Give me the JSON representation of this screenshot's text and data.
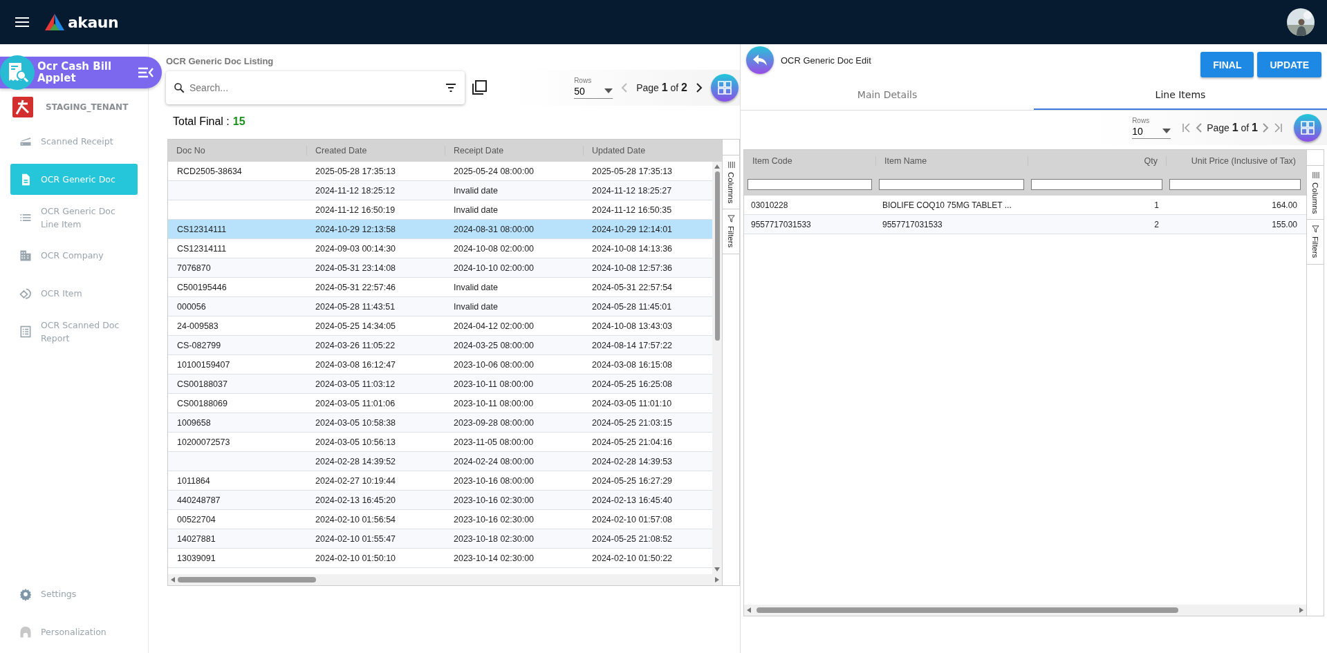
{
  "topbar": {
    "brand": "akaun"
  },
  "sidebar": {
    "app_title": "Ocr Cash Bill Applet",
    "tenant": "STAGING_TENANT",
    "items": [
      {
        "kind": "scanner",
        "label": "Scanned Receipt",
        "selected": false
      },
      {
        "kind": "file",
        "label": "OCR Generic Doc",
        "selected": true
      },
      {
        "kind": "list",
        "label": "OCR Generic Doc Line Item",
        "selected": false
      },
      {
        "kind": "building",
        "label": "OCR Company",
        "selected": false
      },
      {
        "kind": "rotate",
        "label": "OCR Item",
        "selected": false
      },
      {
        "kind": "report",
        "label": "OCR Scanned Doc Report",
        "selected": false
      }
    ],
    "footer_items": [
      {
        "kind": "gear",
        "label": "Settings"
      },
      {
        "kind": "person",
        "label": "Personalization"
      }
    ]
  },
  "listing": {
    "title": "OCR Generic Doc Listing",
    "search": {
      "placeholder": "Search..."
    },
    "rows_label": "Rows",
    "rows_value": "50",
    "page": "Page **1** of **2**",
    "total_label": "Total Final :",
    "total_value": "15",
    "columns": [
      "Doc No",
      "Created Date",
      "Receipt Date",
      "Updated Date"
    ],
    "side_tabs": [
      {
        "kind": "columns",
        "label": "Columns"
      },
      {
        "kind": "filters",
        "label": "Filters"
      }
    ],
    "rows": [
      {
        "cells": [
          "RCD2505-38634",
          "2025-05-28 17:35:13",
          "2025-05-24 08:00:00",
          "2025-05-28 17:35:13"
        ],
        "selected": false
      },
      {
        "cells": [
          "",
          "2024-11-12 18:25:12",
          "Invalid date",
          "2024-11-12 18:25:27"
        ],
        "selected": false
      },
      {
        "cells": [
          "",
          "2024-11-12 16:50:19",
          "Invalid date",
          "2024-11-12 16:50:35"
        ],
        "selected": false
      },
      {
        "cells": [
          "CS12314111",
          "2024-10-29 12:13:58",
          "2024-08-31 08:00:00",
          "2024-10-29 12:14:01"
        ],
        "selected": true
      },
      {
        "cells": [
          "CS12314111",
          "2024-09-03 00:14:30",
          "2024-10-08 02:00:00",
          "2024-10-08 14:13:36"
        ],
        "selected": false
      },
      {
        "cells": [
          "7076870",
          "2024-05-31 23:14:08",
          "2024-10-10 02:00:00",
          "2024-10-08 12:57:36"
        ],
        "selected": false
      },
      {
        "cells": [
          "C500195446",
          "2024-05-31 22:57:46",
          "Invalid date",
          "2024-05-31 22:57:54"
        ],
        "selected": false
      },
      {
        "cells": [
          "000056",
          "2024-05-28 11:43:51",
          "Invalid date",
          "2024-05-28 11:45:01"
        ],
        "selected": false
      },
      {
        "cells": [
          "24-009583",
          "2024-05-25 14:34:05",
          "2024-04-12 02:00:00",
          "2024-10-08 13:43:03"
        ],
        "selected": false
      },
      {
        "cells": [
          "CS-082799",
          "2024-03-26 11:05:22",
          "2024-03-25 08:00:00",
          "2024-08-14 17:57:22"
        ],
        "selected": false
      },
      {
        "cells": [
          "10100159407",
          "2024-03-08 16:12:47",
          "2023-10-06 08:00:00",
          "2024-03-08 16:15:08"
        ],
        "selected": false
      },
      {
        "cells": [
          "CS00188037",
          "2024-03-05 11:03:12",
          "2023-10-11 08:00:00",
          "2024-05-25 16:25:08"
        ],
        "selected": false
      },
      {
        "cells": [
          "CS00188069",
          "2024-03-05 11:01:06",
          "2023-10-11 08:00:00",
          "2024-03-05 11:01:10"
        ],
        "selected": false
      },
      {
        "cells": [
          "1009658",
          "2024-03-05 10:58:38",
          "2023-09-28 08:00:00",
          "2024-05-25 21:03:15"
        ],
        "selected": false
      },
      {
        "cells": [
          "10200072573",
          "2024-03-05 10:56:13",
          "2023-11-05 08:00:00",
          "2024-05-25 21:04:16"
        ],
        "selected": false
      },
      {
        "cells": [
          "",
          "2024-02-28 14:39:52",
          "2024-02-24 08:00:00",
          "2024-02-28 14:39:53"
        ],
        "selected": false
      },
      {
        "cells": [
          "1011864",
          "2024-02-27 10:19:44",
          "2023-10-16 08:00:00",
          "2024-05-25 16:27:29"
        ],
        "selected": false
      },
      {
        "cells": [
          "440248787",
          "2024-02-13 16:45:20",
          "2023-10-16 02:30:00",
          "2024-02-13 16:45:40"
        ],
        "selected": false
      },
      {
        "cells": [
          "00522704",
          "2024-02-10 01:56:54",
          "2023-10-16 02:30:00",
          "2024-02-10 01:57:08"
        ],
        "selected": false
      },
      {
        "cells": [
          "14027881",
          "2024-02-10 01:55:47",
          "2023-10-18 02:30:00",
          "2024-05-25 21:08:52"
        ],
        "selected": false
      },
      {
        "cells": [
          "13039091",
          "2024-02-10 01:50:10",
          "2023-10-14 02:30:00",
          "2024-02-10 01:50:22"
        ],
        "selected": false
      }
    ]
  },
  "editor": {
    "title": "OCR Generic Doc Edit",
    "buttons": [
      "FINAL",
      "UPDATE"
    ],
    "tabs": [
      {
        "label": "Main Details",
        "selected": false
      },
      {
        "label": "Line Items",
        "selected": true
      }
    ],
    "rows_label": "Rows",
    "rows_value": "10",
    "page": "Page **1** of **1**",
    "columns": [
      "Item Code",
      "Item Name",
      "Qty",
      "Unit Price (Inclusive of Tax)"
    ],
    "side_tabs": [
      {
        "kind": "columns",
        "label": "Columns"
      },
      {
        "kind": "filters",
        "label": "Filters"
      }
    ],
    "rows": [
      {
        "cells": [
          "03010228",
          "BIOLIFE COQ10 75MG TABLET ...",
          "1",
          "164.00"
        ]
      },
      {
        "cells": [
          "9557717031533",
          "9557717031533",
          "2",
          "155.00"
        ]
      }
    ]
  }
}
